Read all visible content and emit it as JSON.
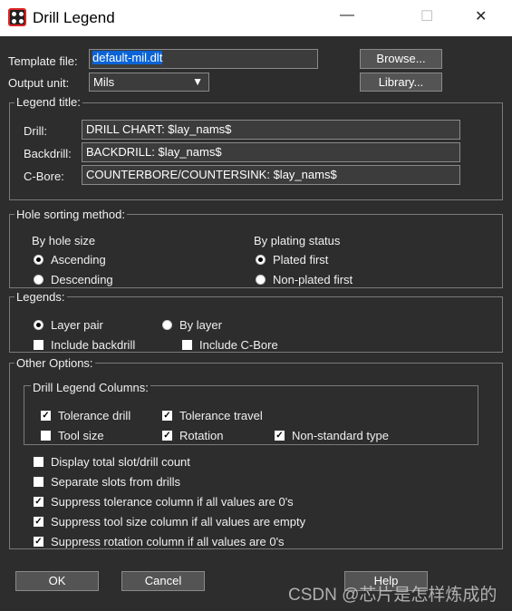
{
  "window": {
    "title": "Drill Legend",
    "minimize": "—",
    "maximize": "☐",
    "close": "✕"
  },
  "template": {
    "label": "Template file:",
    "value": "default-mil.dlt",
    "browse": "Browse..."
  },
  "output": {
    "label": "Output unit:",
    "value": "Mils",
    "library": "Library..."
  },
  "legend_title": {
    "label": "Legend title:",
    "rows": [
      {
        "label": "Drill:",
        "value": "DRILL CHART: $lay_nams$"
      },
      {
        "label": "Backdrill:",
        "value": "BACKDRILL: $lay_nams$"
      },
      {
        "label": "C-Bore:",
        "value": "COUNTERBORE/COUNTERSINK: $lay_nams$"
      }
    ]
  },
  "sorting": {
    "label": "Hole sorting method:",
    "by_size": "By hole size",
    "ascending": "Ascending",
    "descending": "Descending",
    "by_plating": "By plating status",
    "plated_first": "Plated first",
    "nonplated_first": "Non-plated first",
    "size_selected": "Ascending",
    "plating_selected": "Plated first"
  },
  "legends": {
    "label": "Legends:",
    "layer_pair": "Layer pair",
    "by_layer": "By layer",
    "selected": "Layer pair",
    "include_backdrill": {
      "label": "Include backdrill",
      "checked": false
    },
    "include_cbore": {
      "label": "Include C-Bore",
      "checked": false
    }
  },
  "other": {
    "label": "Other Options:",
    "columns_label": "Drill Legend Columns:",
    "columns": [
      {
        "label": "Tolerance drill",
        "checked": true
      },
      {
        "label": "Tolerance travel",
        "checked": true
      },
      {
        "label": "Tool size",
        "checked": false
      },
      {
        "label": "Rotation",
        "checked": true
      },
      {
        "label": "Non-standard type",
        "checked": true
      }
    ],
    "options": [
      {
        "label": "Display total slot/drill count",
        "checked": false
      },
      {
        "label": "Separate slots from drills",
        "checked": false
      },
      {
        "label": "Suppress tolerance column if all values are 0's",
        "checked": true
      },
      {
        "label": "Suppress tool size column if all values are empty",
        "checked": true
      },
      {
        "label": "Suppress rotation column if all values are 0's",
        "checked": true
      }
    ]
  },
  "buttons": {
    "ok": "OK",
    "cancel": "Cancel",
    "help": "Help"
  },
  "watermark": "CSDN @芯片是怎样炼成的"
}
